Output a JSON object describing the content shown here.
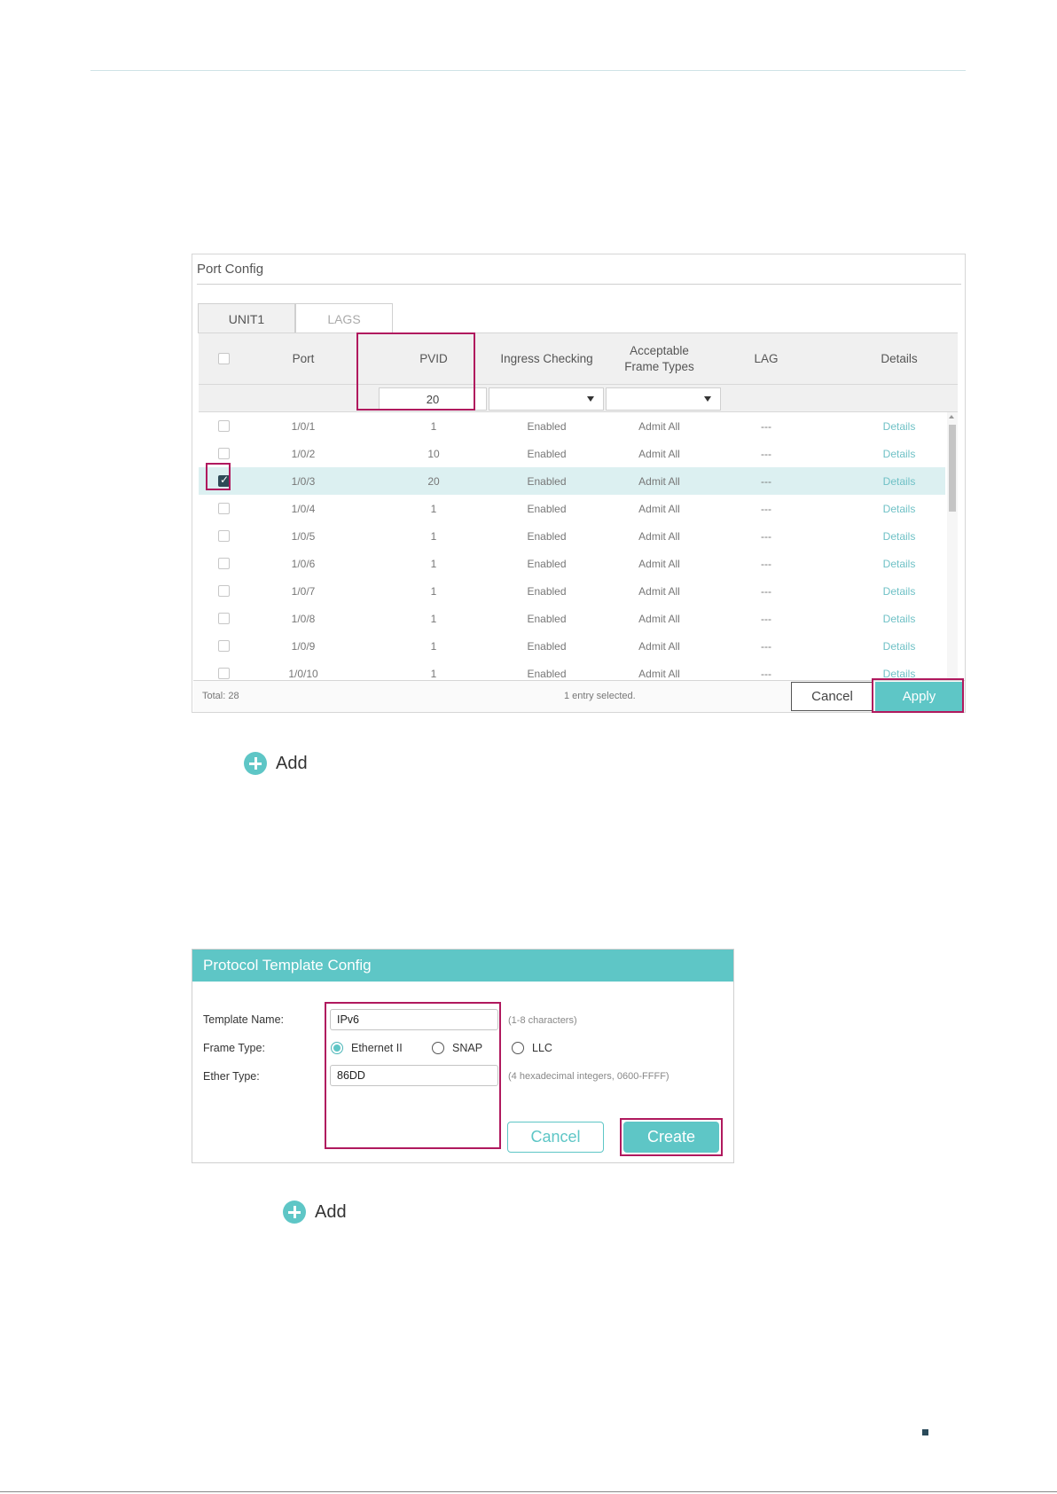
{
  "port_config": {
    "title": "Port Config",
    "tabs": [
      "UNIT1",
      "LAGS"
    ],
    "columns": {
      "port": "Port",
      "pvid": "PVID",
      "ingress": "Ingress Checking",
      "frame_types": "Acceptable Frame Types",
      "lag": "LAG",
      "details": "Details"
    },
    "filter": {
      "pvid_value": "20"
    },
    "rows": [
      {
        "port": "1/0/1",
        "pvid": "1",
        "ingress": "Enabled",
        "frame": "Admit All",
        "lag": "---",
        "details": "Details",
        "checked": false
      },
      {
        "port": "1/0/2",
        "pvid": "10",
        "ingress": "Enabled",
        "frame": "Admit All",
        "lag": "---",
        "details": "Details",
        "checked": false
      },
      {
        "port": "1/0/3",
        "pvid": "20",
        "ingress": "Enabled",
        "frame": "Admit All",
        "lag": "---",
        "details": "Details",
        "checked": true
      },
      {
        "port": "1/0/4",
        "pvid": "1",
        "ingress": "Enabled",
        "frame": "Admit All",
        "lag": "---",
        "details": "Details",
        "checked": false
      },
      {
        "port": "1/0/5",
        "pvid": "1",
        "ingress": "Enabled",
        "frame": "Admit All",
        "lag": "---",
        "details": "Details",
        "checked": false
      },
      {
        "port": "1/0/6",
        "pvid": "1",
        "ingress": "Enabled",
        "frame": "Admit All",
        "lag": "---",
        "details": "Details",
        "checked": false
      },
      {
        "port": "1/0/7",
        "pvid": "1",
        "ingress": "Enabled",
        "frame": "Admit All",
        "lag": "---",
        "details": "Details",
        "checked": false
      },
      {
        "port": "1/0/8",
        "pvid": "1",
        "ingress": "Enabled",
        "frame": "Admit All",
        "lag": "---",
        "details": "Details",
        "checked": false
      },
      {
        "port": "1/0/9",
        "pvid": "1",
        "ingress": "Enabled",
        "frame": "Admit All",
        "lag": "---",
        "details": "Details",
        "checked": false
      },
      {
        "port": "1/0/10",
        "pvid": "1",
        "ingress": "Enabled",
        "frame": "Admit All",
        "lag": "---",
        "details": "Details",
        "checked": false
      }
    ],
    "footer": {
      "total": "Total: 28",
      "selected": "1 entry selected.",
      "cancel": "Cancel",
      "apply": "Apply"
    }
  },
  "add_label": "Add",
  "protocol_template": {
    "title": "Protocol Template Config",
    "template_name_label": "Template Name:",
    "template_name_value": "IPv6",
    "template_name_hint": "(1-8 characters)",
    "frame_type_label": "Frame Type:",
    "frame_types": [
      "Ethernet II",
      "SNAP",
      "LLC"
    ],
    "frame_type_selected": "Ethernet II",
    "ether_type_label": "Ether Type:",
    "ether_type_value": "86DD",
    "ether_type_hint": "(4 hexadecimal integers, 0600-FFFF)",
    "cancel": "Cancel",
    "create": "Create"
  },
  "colors": {
    "accent": "#5ec6c6",
    "highlight": "#b0195e",
    "selected_row": "#dcf0f1"
  }
}
